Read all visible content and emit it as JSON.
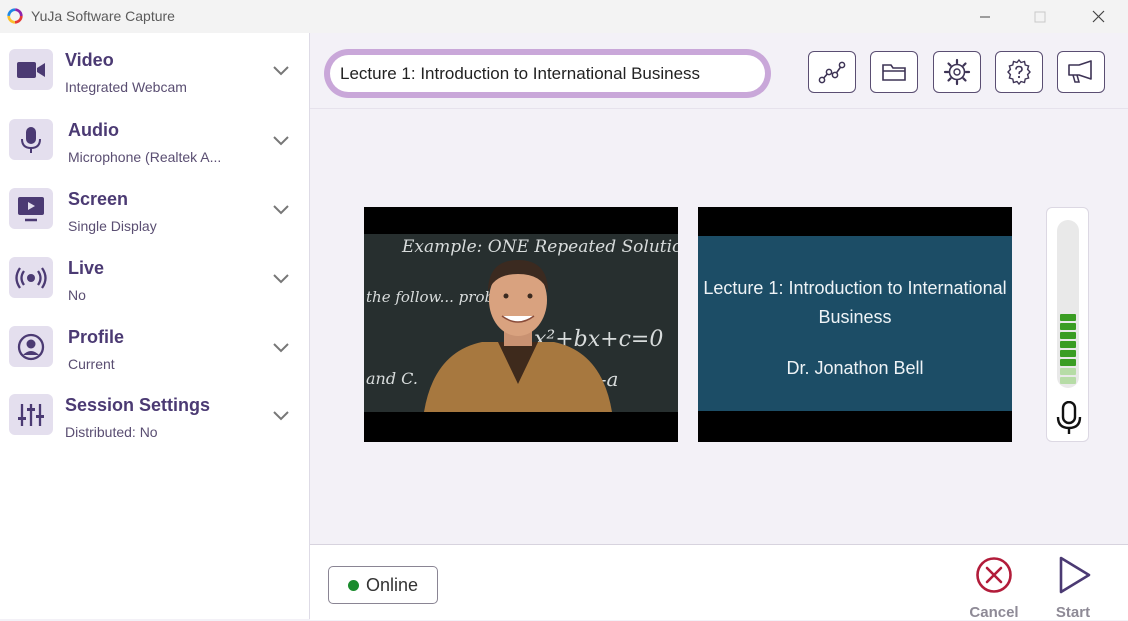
{
  "window": {
    "title": "YuJa Software Capture"
  },
  "sidebar": {
    "items": [
      {
        "title": "Video",
        "subtitle": "Integrated Webcam"
      },
      {
        "title": "Audio",
        "subtitle": "Microphone (Realtek A..."
      },
      {
        "title": "Screen",
        "subtitle": "Single Display"
      },
      {
        "title": "Live",
        "subtitle": "No"
      },
      {
        "title": "Profile",
        "subtitle": "Current"
      },
      {
        "title": "Session Settings",
        "subtitle": "Distributed: No"
      }
    ]
  },
  "session": {
    "title_value": "Lecture 1: Introduction to International Business"
  },
  "toolbar": {
    "icons": [
      "analytics-icon",
      "folder-icon",
      "settings-gear-icon",
      "help-icon",
      "announcement-icon"
    ]
  },
  "preview": {
    "chalkboard_text": [
      "Example: ONE Repeated Solution",
      "the follow... problem.",
      "x²+bx+c=0",
      "and C.",
      "x²+bx-c-a"
    ],
    "slide": {
      "title": "Lecture 1: Introduction to International Business",
      "author": "Dr. Jonathon Bell"
    }
  },
  "meter": {
    "level": 0.47,
    "active_color": "#3a9d23",
    "inactive_color": "#b6dca6"
  },
  "status": {
    "online_label": "Online",
    "online_color": "#1a8b2d"
  },
  "actions": {
    "cancel_label": "Cancel",
    "start_label": "Start"
  },
  "colors": {
    "accent": "#4b3a73",
    "cancel": "#b21c3a",
    "highlight": "#c9a7d9"
  }
}
